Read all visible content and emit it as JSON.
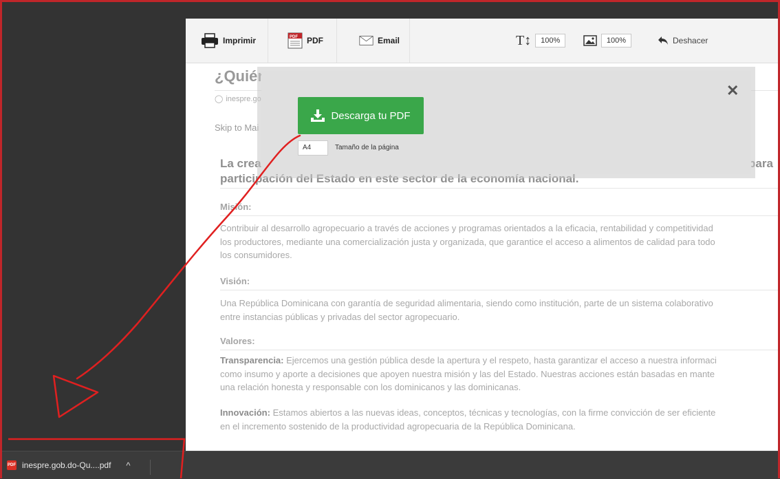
{
  "toolbar": {
    "print_label": "Imprimir",
    "pdf_label": "PDF",
    "email_label": "Email",
    "text_size": "100%",
    "image_size": "100%",
    "undo_label": "Deshacer"
  },
  "article": {
    "title": "¿Quién",
    "source": "inespre.go",
    "skip": "Skip to Mai",
    "lead_start": "La crea",
    "lead_end": "para",
    "lead_line2": "participación del Estado en este sector de la economía nacional.",
    "mision_heading": "Misión:",
    "mision_lines": [
      "Contribuir al desarrollo agropecuario a través de acciones y programas orientados a la eficacia, rentabilidad y competitividad",
      "los productores, mediante una comercialización justa y organizada, que garantice el acceso a alimentos de calidad para todo",
      "los consumidores."
    ],
    "vision_heading": "Visión:",
    "vision_lines": [
      "Una República Dominicana con garantía de seguridad alimentaria, siendo como institución, parte de un sistema colaborativo",
      "entre instancias públicas y privadas del sector agropecuario."
    ],
    "valores_heading": "Valores:",
    "transparencia_term": "Transparencia:",
    "transparencia_lines": [
      " Ejercemos una gestión pública desde la apertura y el respeto, hasta garantizar el acceso a nuestra informaci",
      "como insumo y aporte a decisiones que apoyen nuestra misión y las del Estado. Nuestras acciones están basadas en mante",
      "una relación honesta y responsable con los dominicanos y las dominicanas."
    ],
    "innovacion_term": "Innovación:",
    "innovacion_lines": [
      " Estamos abiertos a las nuevas ideas, conceptos, técnicas y tecnologías, con la firme convicción de ser eficiente",
      "en el incremento sostenido de la productividad agropecuaria de la República Dominicana."
    ]
  },
  "modal": {
    "download_label": "Descarga tu PDF",
    "page_size_value": "A4",
    "page_size_label": "Tamaño de la página",
    "close_glyph": "✕"
  },
  "download_bar": {
    "file_name": "inespre.gob.do-Qu....pdf",
    "file_badge": "PDF",
    "chevron": "^"
  },
  "colors": {
    "download_green": "#3aa74a",
    "annotation_red": "#e02020"
  }
}
